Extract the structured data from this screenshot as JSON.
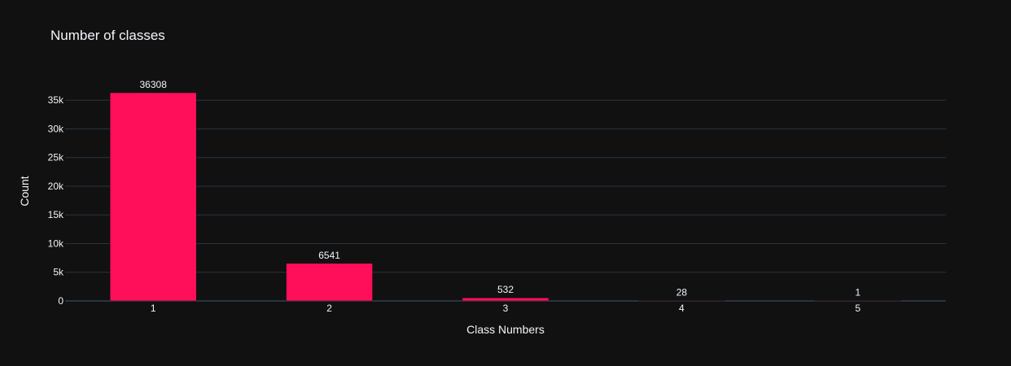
{
  "chart_data": {
    "type": "bar",
    "title": "Number of classes",
    "xlabel": "Class Numbers",
    "ylabel": "Count",
    "categories": [
      "1",
      "2",
      "3",
      "4",
      "5"
    ],
    "values": [
      36308,
      6541,
      532,
      28,
      1
    ],
    "data_labels": [
      "36308",
      "6541",
      "532",
      "28",
      "1"
    ],
    "ylim": [
      0,
      36308
    ],
    "y_ticks": [
      0,
      5000,
      10000,
      15000,
      20000,
      25000,
      30000,
      35000
    ],
    "y_tick_labels": [
      "0",
      "5k",
      "10k",
      "15k",
      "20k",
      "25k",
      "30k",
      "35k"
    ],
    "grid": true,
    "legend": "none",
    "colors": {
      "bar": "#ff0e5a",
      "background": "#111111",
      "grid": "#283442",
      "text": "#f2f5fa"
    }
  }
}
